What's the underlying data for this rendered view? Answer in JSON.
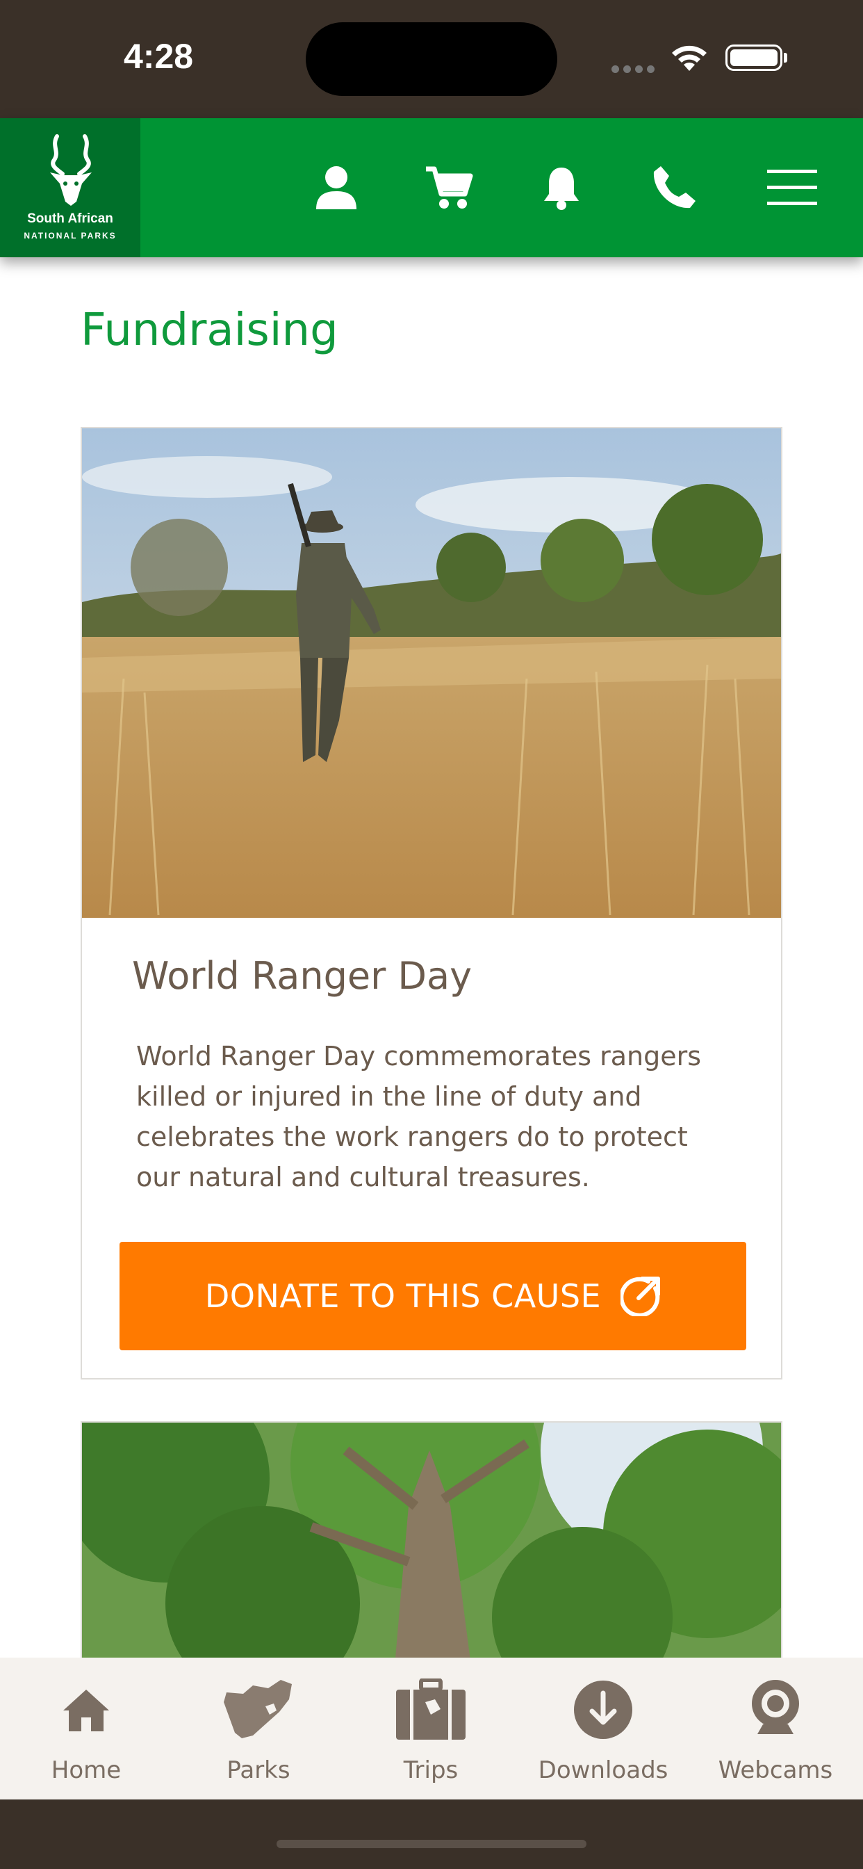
{
  "status_bar": {
    "time": "4:28"
  },
  "header": {
    "logo_line1": "South African",
    "logo_line2": "NATIONAL PARKS",
    "icons": [
      "user-icon",
      "cart-icon",
      "bell-icon",
      "phone-icon",
      "menu-icon"
    ]
  },
  "page": {
    "title": "Fundraising"
  },
  "cards": [
    {
      "title": "World Ranger Day",
      "description": "World Ranger Day commemorates rangers killed or injured in the line of duty and celebrates the work rangers do to protect our natural and cultural treasures.",
      "button_label": "DONATE TO THIS CAUSE"
    }
  ],
  "tabbar": {
    "tabs": [
      {
        "label": "Home",
        "icon": "home-icon"
      },
      {
        "label": "Parks",
        "icon": "map-icon"
      },
      {
        "label": "Trips",
        "icon": "suitcase-icon"
      },
      {
        "label": "Downloads",
        "icon": "download-icon"
      },
      {
        "label": "Webcams",
        "icon": "webcam-icon"
      }
    ]
  },
  "colors": {
    "brand_green": "#009434",
    "logo_green": "#00702a",
    "title_green": "#0f9a3c",
    "donate_orange": "#ff7a00",
    "text_brown": "#6b5b4d",
    "tab_icon": "#7a6d62"
  }
}
